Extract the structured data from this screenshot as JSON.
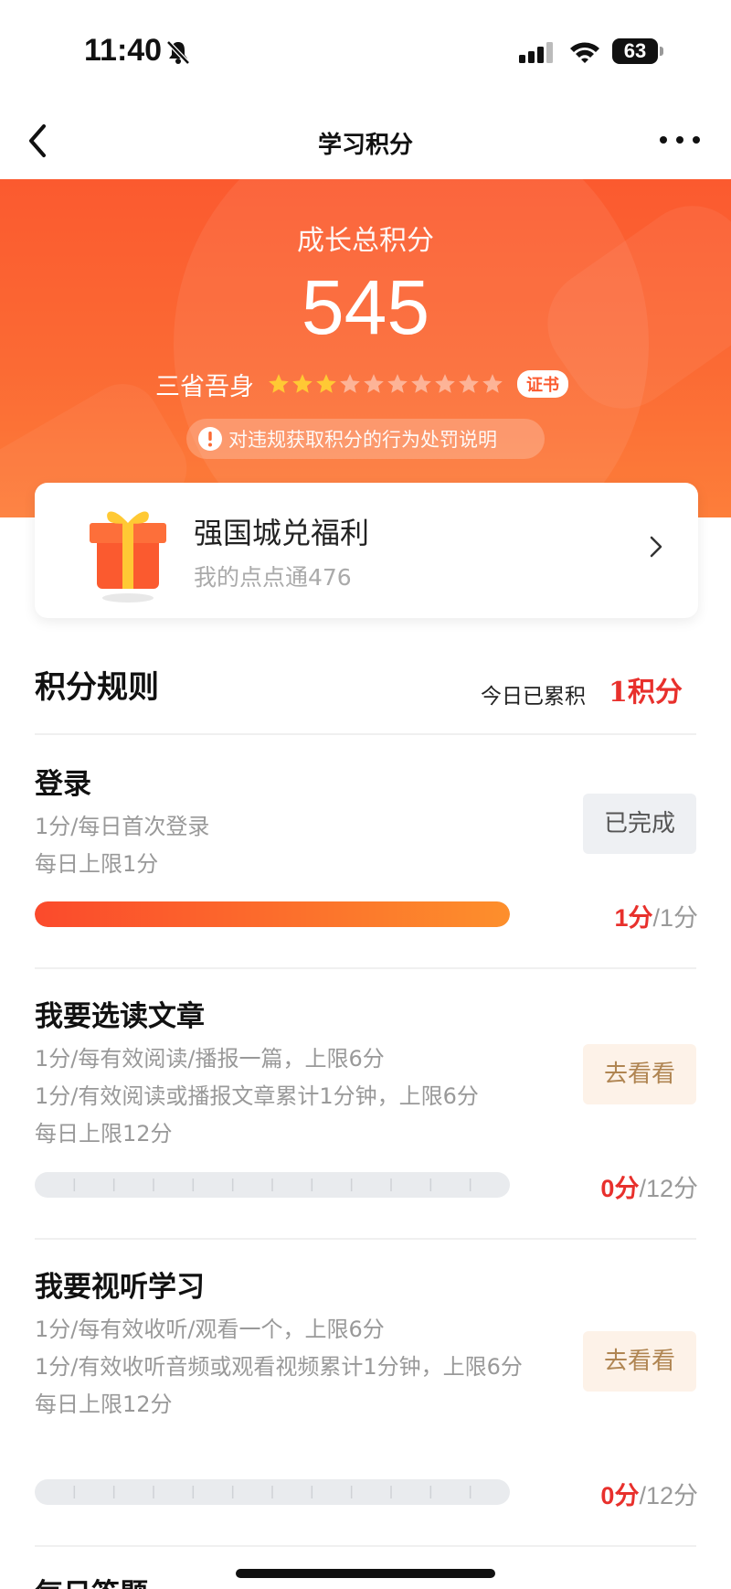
{
  "status_bar": {
    "time": "11:40",
    "battery": "63"
  },
  "nav": {
    "title": "学习积分"
  },
  "hero": {
    "label": "成长总积分",
    "score": "545",
    "rank_name": "三省吾身",
    "stars_filled": 3,
    "stars_total": 10,
    "cert_label": "证书",
    "violation_text": "对违规获取积分的行为处罚说明"
  },
  "welfare": {
    "title": "强国城兑福利",
    "subtitle": "我的点点通476"
  },
  "rules": {
    "title": "积分规则",
    "today_label": "今日已累积",
    "today_value": "1积分",
    "items": [
      {
        "title": "登录",
        "desc": [
          "1分/每日首次登录",
          "每日上限1分"
        ],
        "button": "已完成",
        "earned": "1分",
        "limit": "/1分",
        "progress": 1.0
      },
      {
        "title": "我要选读文章",
        "desc": [
          "1分/每有效阅读/播报一篇，上限6分",
          "1分/有效阅读或播报文章累计1分钟，上限6分",
          "每日上限12分"
        ],
        "button": "去看看",
        "earned": "0分",
        "limit": "/12分",
        "progress": 0
      },
      {
        "title": "我要视听学习",
        "desc": [
          "1分/每有效收听/观看一个，上限6分",
          "1分/有效收听音频或观看视频累计1分钟，上限6分",
          "每日上限12分"
        ],
        "button": "去看看",
        "earned": "0分",
        "limit": "/12分",
        "progress": 0
      },
      {
        "title": "每日答题"
      }
    ]
  },
  "colors": {
    "brand": "#fb5a2f",
    "accent_red": "#e8302c",
    "star": "#ffc934"
  }
}
